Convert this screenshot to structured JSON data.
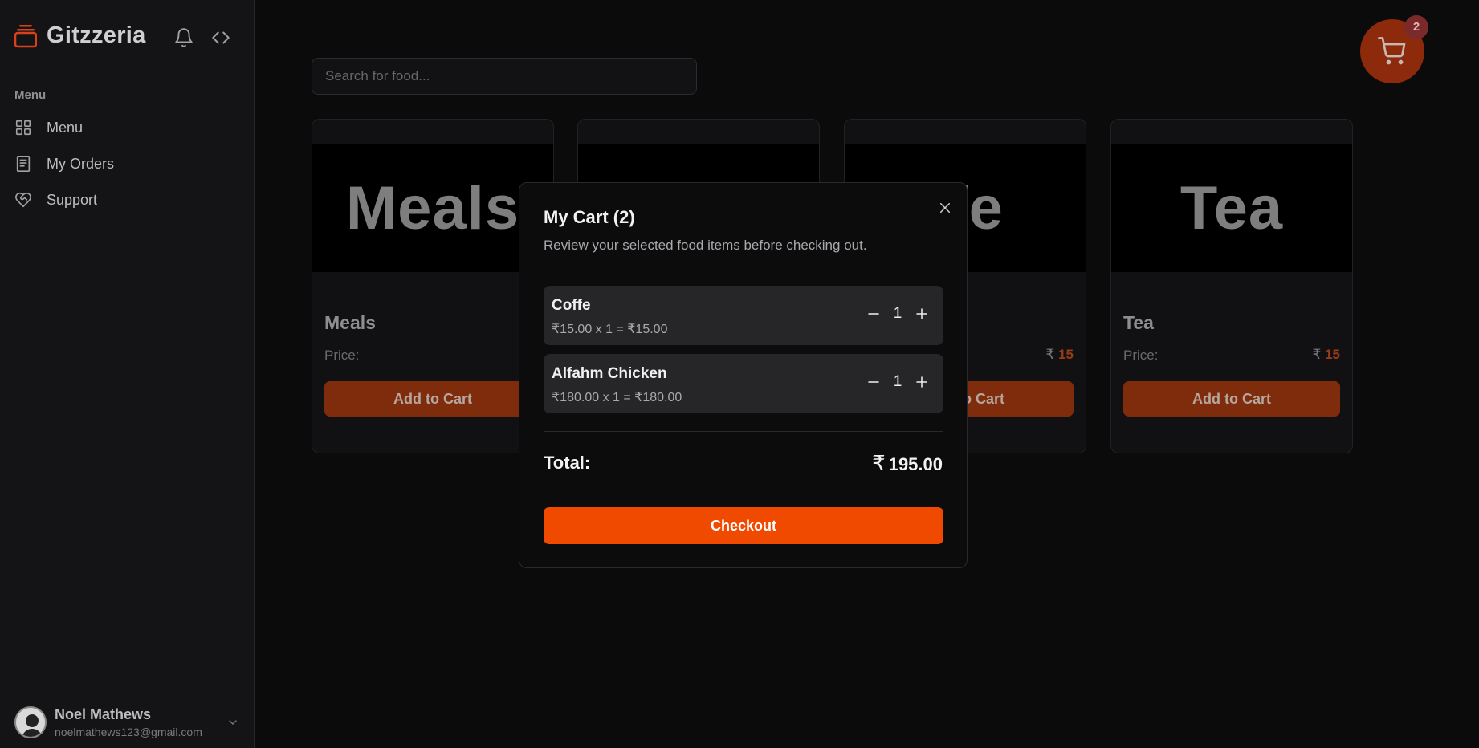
{
  "app": {
    "name": "Gitzzeria"
  },
  "sidebar": {
    "heading": "Menu",
    "items": [
      {
        "label": "Menu",
        "icon": "grid-icon"
      },
      {
        "label": "My Orders",
        "icon": "receipt-icon"
      },
      {
        "label": "Support",
        "icon": "heart-handshake-icon"
      }
    ],
    "user": {
      "name": "Noel Mathews",
      "email": "noelmathews123@gmail.com"
    }
  },
  "search": {
    "placeholder": "Search for food..."
  },
  "cart_badge": "2",
  "price_label": "Price:",
  "add_label": "Add to Cart",
  "currency": "₹",
  "cards": [
    {
      "image_text": "Meals",
      "title": "Meals",
      "price": ""
    },
    {
      "image_text": "",
      "title": "",
      "price": ""
    },
    {
      "image_text": "ffe",
      "title": "",
      "price": "15"
    },
    {
      "image_text": "Tea",
      "title": "Tea",
      "price": "15"
    }
  ],
  "modal": {
    "title": "My Cart (2)",
    "subtitle": "Review your selected food items before checking out.",
    "items": [
      {
        "name": "Coffe",
        "calc": "₹15.00 x 1 = ₹15.00",
        "qty": "1"
      },
      {
        "name": "Alfahm Chicken",
        "calc": "₹180.00 x 1 = ₹180.00",
        "qty": "1"
      }
    ],
    "total_label": "Total:",
    "total_value": "195.00",
    "checkout_label": "Checkout"
  },
  "colors": {
    "accent": "#f04a00",
    "accent_dim": "#7f2c0c",
    "background": "#0b0b0c"
  }
}
